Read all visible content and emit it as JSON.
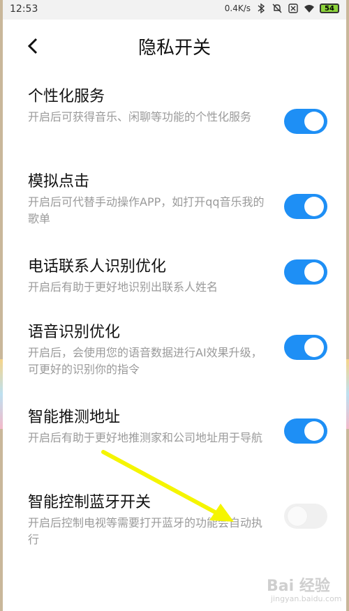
{
  "status_bar": {
    "time": "12:53",
    "speed": "0.4K/s",
    "battery": "54",
    "icons": [
      "bluetooth-icon",
      "mute-bell-icon",
      "sim-x-icon",
      "wifi-icon",
      "battery-icon"
    ]
  },
  "header": {
    "title": "隐私开关",
    "back_icon": "chevron-left-icon"
  },
  "colors": {
    "toggle_on": "#1e8ff5",
    "toggle_off": "#f0f0f0",
    "arrow": "#f5f500"
  },
  "settings": [
    {
      "title": "个性化服务",
      "desc": "开启后可获得音乐、闲聊等功能的个性化服务",
      "on": true
    },
    {
      "title": "模拟点击",
      "desc": "开启后可代替手动操作APP，如打开qq音乐我的歌单",
      "on": true
    },
    {
      "title": "电话联系人识别优化",
      "desc": "开启后有助于更好地识别出联系人姓名",
      "on": true
    },
    {
      "title": "语音识别优化",
      "desc": "开启后，会使用您的语音数据进行AI效果升级，可更好的识别你的指令",
      "on": true
    },
    {
      "title": "智能推测地址",
      "desc": "开启后有助于更好地推测家和公司地址用于导航",
      "on": true
    },
    {
      "title": "智能控制蓝牙开关",
      "desc": "开启后控制电视等需要打开蓝牙的功能会自动执行",
      "on": false
    }
  ],
  "watermark": {
    "brand": "Bai 经验",
    "sub": "jingyan.baidu.com"
  }
}
